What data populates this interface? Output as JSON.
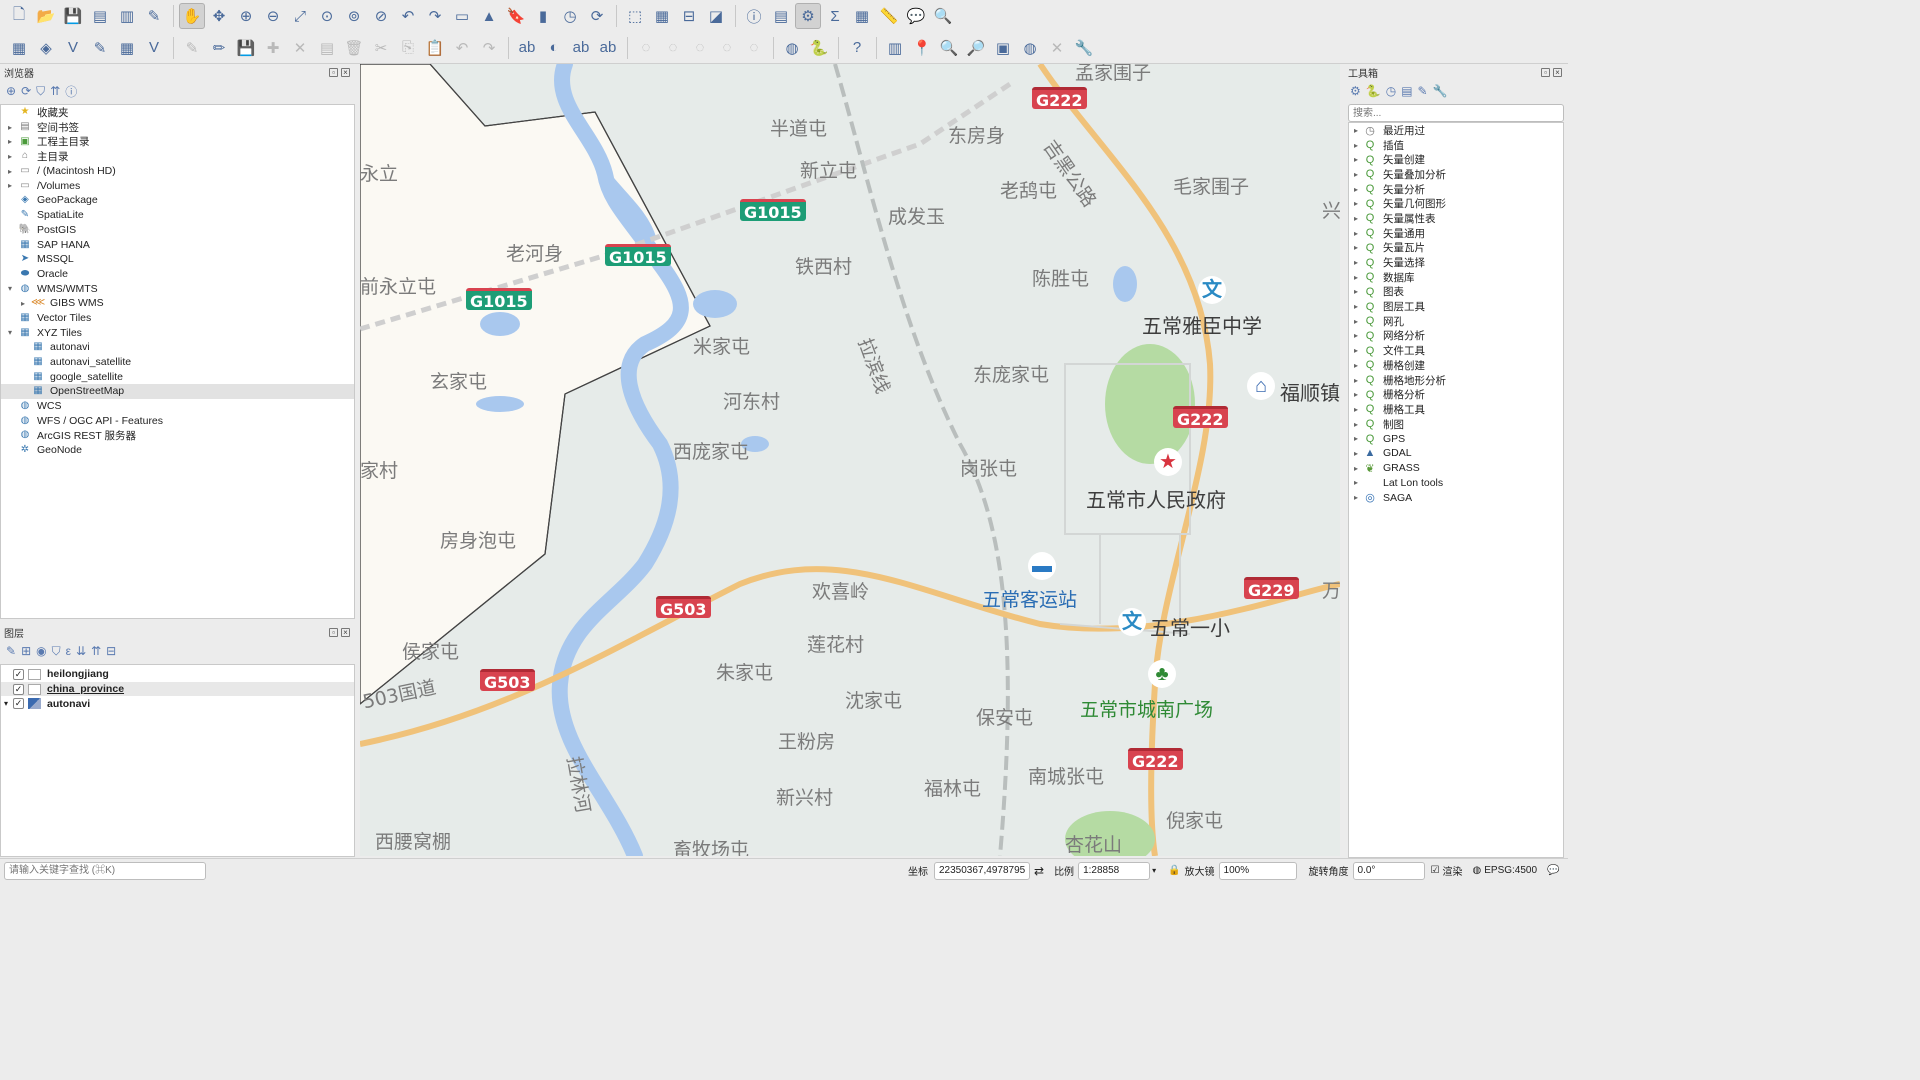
{
  "toolbar1": [
    {
      "name": "new-project-icon"
    },
    {
      "name": "open-project-icon"
    },
    {
      "name": "save-project-icon"
    },
    {
      "name": "new-print-layout-icon"
    },
    {
      "name": "layout-manager-icon"
    },
    {
      "name": "style-manager-icon"
    },
    {
      "sep": true
    },
    {
      "name": "pan-icon",
      "active": true
    },
    {
      "name": "pan-to-selection-icon"
    },
    {
      "name": "zoom-in-icon"
    },
    {
      "name": "zoom-out-icon"
    },
    {
      "name": "zoom-full-icon"
    },
    {
      "name": "zoom-to-selection-icon"
    },
    {
      "name": "zoom-to-layer-icon"
    },
    {
      "name": "zoom-native-icon"
    },
    {
      "name": "zoom-last-icon"
    },
    {
      "name": "zoom-next-icon"
    },
    {
      "name": "new-map-view-icon"
    },
    {
      "name": "new-3d-view-icon"
    },
    {
      "name": "new-bookmark-icon"
    },
    {
      "name": "show-bookmarks-icon"
    },
    {
      "name": "temporal-controller-icon"
    },
    {
      "name": "refresh-icon"
    },
    {
      "sep": true
    },
    {
      "name": "select-features-icon"
    },
    {
      "name": "select-by-value-icon"
    },
    {
      "name": "deselect-icon"
    },
    {
      "name": "select-location-icon"
    },
    {
      "sep": true
    },
    {
      "name": "identify-icon"
    },
    {
      "name": "attribute-table-icon"
    },
    {
      "name": "toolbox-icon",
      "active": true
    },
    {
      "name": "statistics-icon"
    },
    {
      "name": "field-calculator-icon"
    },
    {
      "name": "measure-icon"
    },
    {
      "name": "map-tips-icon"
    },
    {
      "name": "locator-icon"
    }
  ],
  "toolbar2": [
    {
      "name": "data-source-manager-icon"
    },
    {
      "name": "new-geopackage-icon"
    },
    {
      "name": "new-shapefile-icon"
    },
    {
      "name": "digitize-icon"
    },
    {
      "name": "new-virtual-layer-icon"
    },
    {
      "name": "toggle-editing-icon"
    },
    {
      "sep": true
    },
    {
      "name": "edit-pencil-icon",
      "dim": true
    },
    {
      "name": "pencil-icon"
    },
    {
      "name": "save-edits-icon",
      "dim": true
    },
    {
      "name": "add-feature-icon",
      "dim": true
    },
    {
      "name": "vertex-tool-icon",
      "dim": true
    },
    {
      "name": "modify-attributes-icon",
      "dim": true
    },
    {
      "name": "delete-selected-icon",
      "dim": true
    },
    {
      "name": "cut-features-icon",
      "dim": true
    },
    {
      "name": "copy-features-icon",
      "dim": true
    },
    {
      "name": "paste-features-icon",
      "dim": true
    },
    {
      "name": "undo-icon",
      "dim": true
    },
    {
      "name": "redo-icon",
      "dim": true
    },
    {
      "sep": true
    },
    {
      "name": "label-tool-icon"
    },
    {
      "name": "diagram-tool-icon"
    },
    {
      "name": "highlight-label-icon"
    },
    {
      "name": "pin-label-icon"
    },
    {
      "sep": true
    },
    {
      "name": "show-hide-labels-icon",
      "dim": true
    },
    {
      "name": "move-label-icon",
      "dim": true
    },
    {
      "name": "rotate-label-icon",
      "dim": true
    },
    {
      "name": "change-label-icon",
      "dim": true
    },
    {
      "name": "label-properties-icon",
      "dim": true
    },
    {
      "sep": true
    },
    {
      "name": "globe-plugin-icon"
    },
    {
      "name": "python-console-icon"
    },
    {
      "sep": true
    },
    {
      "name": "help-icon"
    },
    {
      "sep": true
    },
    {
      "name": "georeferencer-icon"
    },
    {
      "name": "pin-icon"
    },
    {
      "name": "zoom-plugin-icon"
    },
    {
      "name": "zoom-in-plugin-icon"
    },
    {
      "name": "fit-extent-icon"
    },
    {
      "name": "web-icon"
    },
    {
      "name": "crs-icon",
      "dim": true
    },
    {
      "name": "wrench-icon"
    }
  ],
  "browser": {
    "title": "浏览器",
    "items": [
      {
        "label": "收藏夹",
        "icon": "star-icon",
        "glyph": "★",
        "color": "#e3b520",
        "arrow": "",
        "indent": 0
      },
      {
        "label": "空间书签",
        "icon": "bookmark-icon",
        "glyph": "▤",
        "color": "#7a7a7a",
        "arrow": "▸",
        "indent": 0
      },
      {
        "label": "工程主目录",
        "icon": "project-home-icon",
        "glyph": "▣",
        "color": "#4a9a3a",
        "arrow": "▸",
        "indent": 0
      },
      {
        "label": "主目录",
        "icon": "home-folder-icon",
        "glyph": "⌂",
        "color": "#777",
        "arrow": "▸",
        "indent": 0
      },
      {
        "label": "/ (Macintosh HD)",
        "icon": "drive-icon",
        "glyph": "▭",
        "color": "#888",
        "arrow": "▸",
        "indent": 0
      },
      {
        "label": "/Volumes",
        "icon": "folder-icon",
        "glyph": "▭",
        "color": "#888",
        "arrow": "▸",
        "indent": 0
      },
      {
        "label": "GeoPackage",
        "icon": "geopackage-icon",
        "glyph": "◈",
        "color": "#3a78b0",
        "arrow": "",
        "indent": 0
      },
      {
        "label": "SpatiaLite",
        "icon": "spatialite-icon",
        "glyph": "✎",
        "color": "#3a78b0",
        "arrow": "",
        "indent": 0
      },
      {
        "label": "PostGIS",
        "icon": "postgis-icon",
        "glyph": "🐘",
        "color": "#3a78b0",
        "arrow": "",
        "indent": 0
      },
      {
        "label": "SAP HANA",
        "icon": "sap-hana-icon",
        "glyph": "▦",
        "color": "#3a78b0",
        "arrow": "",
        "indent": 0
      },
      {
        "label": "MSSQL",
        "icon": "mssql-icon",
        "glyph": "➤",
        "color": "#3a78b0",
        "arrow": "",
        "indent": 0
      },
      {
        "label": "Oracle",
        "icon": "oracle-icon",
        "glyph": "⬬",
        "color": "#3a78b0",
        "arrow": "",
        "indent": 0
      },
      {
        "label": "WMS/WMTS",
        "icon": "globe-icon",
        "glyph": "◍",
        "color": "#3a78b0",
        "arrow": "▾",
        "indent": 0
      },
      {
        "label": "GIBS WMS",
        "icon": "wms-layer-icon",
        "glyph": "⋘",
        "color": "#d9882a",
        "arrow": "▸",
        "indent": 1
      },
      {
        "label": "Vector Tiles",
        "icon": "vector-tiles-icon",
        "glyph": "▦",
        "color": "#3a78b0",
        "arrow": "",
        "indent": 0
      },
      {
        "label": "XYZ Tiles",
        "icon": "xyz-tiles-icon",
        "glyph": "▦",
        "color": "#3a78b0",
        "arrow": "▾",
        "indent": 0
      },
      {
        "label": "autonavi",
        "icon": "tile-layer-icon",
        "glyph": "▦",
        "color": "#3a78b0",
        "arrow": "",
        "indent": 1
      },
      {
        "label": "autonavi_satellite",
        "icon": "tile-layer-icon",
        "glyph": "▦",
        "color": "#3a78b0",
        "arrow": "",
        "indent": 1
      },
      {
        "label": "google_satellite",
        "icon": "tile-layer-icon",
        "glyph": "▦",
        "color": "#3a78b0",
        "arrow": "",
        "indent": 1
      },
      {
        "label": "OpenStreetMap",
        "icon": "tile-layer-icon",
        "glyph": "▦",
        "color": "#3a78b0",
        "arrow": "",
        "indent": 1,
        "selected": true
      },
      {
        "label": "WCS",
        "icon": "globe-icon",
        "glyph": "◍",
        "color": "#3a78b0",
        "arrow": "",
        "indent": 0
      },
      {
        "label": "WFS / OGC API - Features",
        "icon": "globe-icon",
        "glyph": "◍",
        "color": "#3a78b0",
        "arrow": "",
        "indent": 0
      },
      {
        "label": "ArcGIS REST 服务器",
        "icon": "globe-icon",
        "glyph": "◍",
        "color": "#3a78b0",
        "arrow": "",
        "indent": 0
      },
      {
        "label": "GeoNode",
        "icon": "geonode-icon",
        "glyph": "✲",
        "color": "#3a78b0",
        "arrow": "",
        "indent": 0
      }
    ]
  },
  "layers": {
    "title": "图层",
    "items": [
      {
        "label": "heilongjiang",
        "checked": true,
        "icon": "polygon-layer-icon",
        "arrow": "",
        "underline": false,
        "selected": false
      },
      {
        "label": "china_province",
        "checked": true,
        "icon": "polygon-layer-icon",
        "arrow": "",
        "underline": true,
        "selected": true
      },
      {
        "label": "autonavi",
        "checked": true,
        "icon": "raster-layer-icon",
        "arrow": "▾",
        "underline": false,
        "selected": false
      }
    ]
  },
  "map": {
    "labels": [
      {
        "text": "孟家围子",
        "cls": ""
      },
      {
        "text": "半道屯",
        "cls": ""
      },
      {
        "text": "东房身",
        "cls": ""
      },
      {
        "text": "吉黑公路",
        "cls": ""
      },
      {
        "text": "永立",
        "cls": ""
      },
      {
        "text": "新立屯",
        "cls": ""
      },
      {
        "text": "老鸹屯",
        "cls": ""
      },
      {
        "text": "毛家围子",
        "cls": ""
      },
      {
        "text": "兴",
        "cls": ""
      },
      {
        "text": "成发玉",
        "cls": ""
      },
      {
        "text": "老河身",
        "cls": ""
      },
      {
        "text": "铁西村",
        "cls": ""
      },
      {
        "text": "陈胜屯",
        "cls": ""
      },
      {
        "text": "前永立屯",
        "cls": ""
      },
      {
        "text": "五常雅臣中学",
        "cls": "big"
      },
      {
        "text": "米家屯",
        "cls": ""
      },
      {
        "text": "拉滨线",
        "cls": ""
      },
      {
        "text": "东庞家屯",
        "cls": ""
      },
      {
        "text": "福顺镇",
        "cls": "big"
      },
      {
        "text": "玄家屯",
        "cls": ""
      },
      {
        "text": "河东村",
        "cls": ""
      },
      {
        "text": "西庞家屯",
        "cls": ""
      },
      {
        "text": "岗张屯",
        "cls": ""
      },
      {
        "text": "家村",
        "cls": ""
      },
      {
        "text": "五常市人民政府",
        "cls": "big"
      },
      {
        "text": "房身泡屯",
        "cls": ""
      },
      {
        "text": "五常客运站",
        "cls": "blue"
      },
      {
        "text": "欢喜岭",
        "cls": ""
      },
      {
        "text": "五常一小",
        "cls": "big"
      },
      {
        "text": "万",
        "cls": ""
      },
      {
        "text": "侯家屯",
        "cls": ""
      },
      {
        "text": "莲花村",
        "cls": ""
      },
      {
        "text": "朱家屯",
        "cls": ""
      },
      {
        "text": "503国道",
        "cls": ""
      },
      {
        "text": "沈家屯",
        "cls": ""
      },
      {
        "text": "保安屯",
        "cls": ""
      },
      {
        "text": "五常市城南广场",
        "cls": "green"
      },
      {
        "text": "拉林河",
        "cls": ""
      },
      {
        "text": "王粉房",
        "cls": ""
      },
      {
        "text": "福林屯",
        "cls": ""
      },
      {
        "text": "南城张屯",
        "cls": ""
      },
      {
        "text": "新兴村",
        "cls": ""
      },
      {
        "text": "杏花山",
        "cls": ""
      },
      {
        "text": "倪家屯",
        "cls": ""
      },
      {
        "text": "西腰窝棚",
        "cls": ""
      },
      {
        "text": "畜牧场屯",
        "cls": ""
      }
    ],
    "shields": [
      {
        "text": "G222",
        "type": "red"
      },
      {
        "text": "G1015",
        "type": "grn"
      },
      {
        "text": "G1015",
        "type": "grn"
      },
      {
        "text": "G1015",
        "type": "grn"
      },
      {
        "text": "G222",
        "type": "red"
      },
      {
        "text": "G503",
        "type": "red"
      },
      {
        "text": "G229",
        "type": "red"
      },
      {
        "text": "G503",
        "type": "red"
      },
      {
        "text": "G222",
        "type": "red"
      }
    ],
    "pois": [
      {
        "name": "school-icon",
        "glyph": "文"
      },
      {
        "name": "building-icon",
        "glyph": "⌂"
      },
      {
        "name": "government-star-icon",
        "glyph": "★"
      },
      {
        "name": "bus-station-icon",
        "glyph": "▬"
      },
      {
        "name": "school-icon",
        "glyph": "文"
      },
      {
        "name": "park-tree-icon",
        "glyph": "♣"
      }
    ]
  },
  "toolbox": {
    "title": "工具箱",
    "search_placeholder": "搜索...",
    "items": [
      {
        "label": "最近用过",
        "glyph": "◷",
        "color": "#777"
      },
      {
        "label": "插值",
        "glyph": "Q",
        "color": "#4a9a3a"
      },
      {
        "label": "矢量创建",
        "glyph": "Q",
        "color": "#4a9a3a"
      },
      {
        "label": "矢量叠加分析",
        "glyph": "Q",
        "color": "#4a9a3a"
      },
      {
        "label": "矢量分析",
        "glyph": "Q",
        "color": "#4a9a3a"
      },
      {
        "label": "矢量几何图形",
        "glyph": "Q",
        "color": "#4a9a3a"
      },
      {
        "label": "矢量属性表",
        "glyph": "Q",
        "color": "#4a9a3a"
      },
      {
        "label": "矢量通用",
        "glyph": "Q",
        "color": "#4a9a3a"
      },
      {
        "label": "矢量瓦片",
        "glyph": "Q",
        "color": "#4a9a3a"
      },
      {
        "label": "矢量选择",
        "glyph": "Q",
        "color": "#4a9a3a"
      },
      {
        "label": "数据库",
        "glyph": "Q",
        "color": "#4a9a3a"
      },
      {
        "label": "图表",
        "glyph": "Q",
        "color": "#4a9a3a"
      },
      {
        "label": "图层工具",
        "glyph": "Q",
        "color": "#4a9a3a"
      },
      {
        "label": "网孔",
        "glyph": "Q",
        "color": "#4a9a3a"
      },
      {
        "label": "网络分析",
        "glyph": "Q",
        "color": "#4a9a3a"
      },
      {
        "label": "文件工具",
        "glyph": "Q",
        "color": "#4a9a3a"
      },
      {
        "label": "栅格创建",
        "glyph": "Q",
        "color": "#4a9a3a"
      },
      {
        "label": "栅格地形分析",
        "glyph": "Q",
        "color": "#4a9a3a"
      },
      {
        "label": "栅格分析",
        "glyph": "Q",
        "color": "#4a9a3a"
      },
      {
        "label": "栅格工具",
        "glyph": "Q",
        "color": "#4a9a3a"
      },
      {
        "label": "制图",
        "glyph": "Q",
        "color": "#4a9a3a"
      },
      {
        "label": "GPS",
        "glyph": "Q",
        "color": "#4a9a3a"
      },
      {
        "label": "GDAL",
        "glyph": "▲",
        "color": "#3a6aa0"
      },
      {
        "label": "GRASS",
        "glyph": "❦",
        "color": "#5a9a3a"
      },
      {
        "label": "Lat Lon tools",
        "glyph": "",
        "color": "#777"
      },
      {
        "label": "SAGA",
        "glyph": "◎",
        "color": "#2a6ab0"
      }
    ]
  },
  "status": {
    "search_placeholder": "请输入关键字查找 (⌘K)",
    "coord_label": "坐标",
    "coord_value": "22350367,4978795",
    "scale_label": "比例",
    "scale_value": "1:28858",
    "magnifier_label": "放大镜",
    "magnifier_value": "100%",
    "rotation_label": "旋转角度",
    "rotation_value": "0.0°",
    "render_label": "渲染",
    "crs_label": "EPSG:4500"
  }
}
